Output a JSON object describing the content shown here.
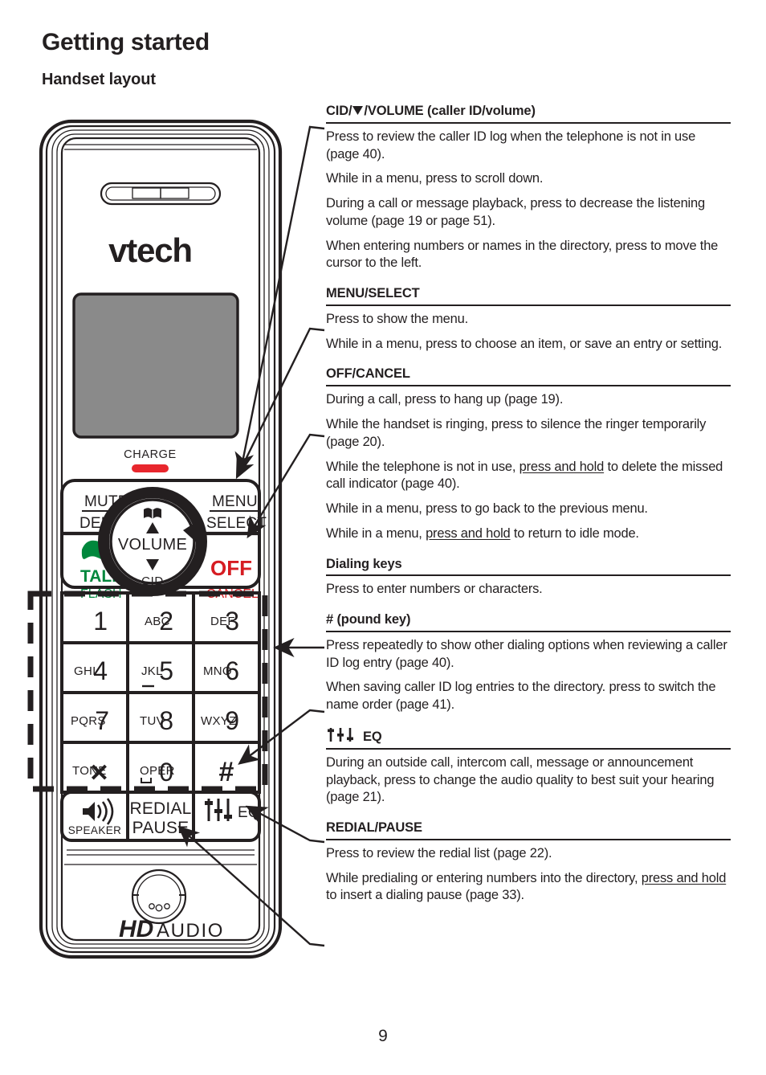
{
  "page": {
    "title": "Getting started",
    "section": "Handset layout",
    "number": "9"
  },
  "descriptions": [
    {
      "id": "cid-volume",
      "heading": "CID/▼/VOLUME (caller ID/volume)",
      "heading_prefix": "CID/",
      "heading_suffix": "/VOLUME (caller ID/volume)",
      "icon": "down-triangle-icon",
      "paragraphs": [
        {
          "text": "Press to review the caller ID log when the telephone is not in use (page 40)."
        },
        {
          "text": "While in a menu, press to scroll down."
        },
        {
          "text": "During a call or message playback, press to decrease the listening volume (page 19 or page 51)."
        },
        {
          "text": "When entering numbers or names in the directory, press to move the cursor to the left."
        }
      ]
    },
    {
      "id": "menu-select",
      "heading": "MENU/SELECT",
      "paragraphs": [
        {
          "text": "Press to show the menu."
        },
        {
          "text": "While in a menu, press to choose an item, or save an entry or setting."
        }
      ]
    },
    {
      "id": "off-cancel",
      "heading": "OFF/CANCEL",
      "paragraphs": [
        {
          "text": "During a call, press to hang up (page 19)."
        },
        {
          "text": "While the handset is ringing, press to silence the ringer temporarily (page 20)."
        },
        {
          "pre": "While the telephone is not in use, ",
          "underline": "press and hold",
          "post": " to delete the missed call indicator (page 40)."
        },
        {
          "text": "While in a menu, press to go back to the previous menu."
        },
        {
          "pre": "While in a menu, ",
          "underline": "press and hold",
          "post": " to return to idle mode."
        }
      ]
    },
    {
      "id": "dialing-keys",
      "heading": "Dialing keys",
      "paragraphs": [
        {
          "text": "Press to enter numbers or characters."
        }
      ]
    },
    {
      "id": "pound-key",
      "heading": "# (pound key)",
      "paragraphs": [
        {
          "text": "Press repeatedly to show other dialing options when reviewing a caller ID log entry (page 40)."
        },
        {
          "text": "When saving caller ID log entries to the directory. press to switch the name order (page 41)."
        }
      ]
    },
    {
      "id": "eq",
      "heading": "EQ",
      "icon": "equalizer-icon",
      "paragraphs": [
        {
          "text": "During an outside call, intercom call, message or announcement playback, press to change the audio quality to best suit your hearing (page 21)."
        }
      ]
    },
    {
      "id": "redial-pause",
      "heading": "REDIAL/PAUSE",
      "paragraphs": [
        {
          "text": "Press to review the redial list (page 22)."
        },
        {
          "pre": "While predialing or entering numbers into the directory, ",
          "underline": "press and hold",
          "post": " to insert a dialing pause (page 33)."
        }
      ]
    }
  ],
  "handset": {
    "brand": "vtech",
    "charge_label": "CHARGE",
    "hd_audio_bold": "HD",
    "hd_audio_light": "AUDIO",
    "nav": {
      "center_label": "VOLUME",
      "up_label": "",
      "down_label": "CID",
      "up_icon": "directory-book-icon",
      "up_arrow_icon": "up-triangle-icon",
      "down_arrow_icon": "down-triangle-icon",
      "right_arrow_icon": "right-triangle-icon"
    },
    "soft_keys": [
      {
        "name": "mute-delete",
        "top": "MUTE",
        "bottom": "DELETE",
        "color": "#231f20"
      },
      {
        "name": "menu-select",
        "top": "MENU",
        "bottom": "SELECT",
        "color": "#231f20"
      },
      {
        "name": "talk-flash",
        "top": "TALK",
        "bottom": "FLASH",
        "color": "#00873c",
        "icon": "handset-icon"
      },
      {
        "name": "off-cancel",
        "top": "OFF",
        "bottom": "CANCEL",
        "color": "#d61c22"
      }
    ],
    "keypad": [
      {
        "letters": "",
        "digit": "1"
      },
      {
        "letters": "ABC",
        "digit": "2"
      },
      {
        "letters": "DEF",
        "digit": "3"
      },
      {
        "letters": "GHI",
        "digit": "4"
      },
      {
        "letters": "JKL",
        "digit": "5"
      },
      {
        "letters": "MNO",
        "digit": "6"
      },
      {
        "letters": "PQRS",
        "digit": "7"
      },
      {
        "letters": "TUV",
        "digit": "8"
      },
      {
        "letters": "WXYZ",
        "digit": "9"
      },
      {
        "letters": "TONE",
        "digit": "✕"
      },
      {
        "letters": "OPER",
        "digit": "0"
      },
      {
        "letters": "",
        "digit": "#"
      }
    ],
    "bottom_keys": [
      {
        "name": "speaker",
        "label": "SPEAKER",
        "icon": "speaker-icon"
      },
      {
        "name": "redial-pause",
        "line1": "REDIAL",
        "line2": "PAUSE"
      },
      {
        "name": "eq",
        "label": "EQ",
        "icon": "equalizer-icon"
      }
    ]
  },
  "colors": {
    "ink": "#231f20",
    "talk_green": "#00873c",
    "off_red": "#d61c22",
    "charge_led": "#e8272d",
    "screen_gray": "#8a8a8a"
  }
}
